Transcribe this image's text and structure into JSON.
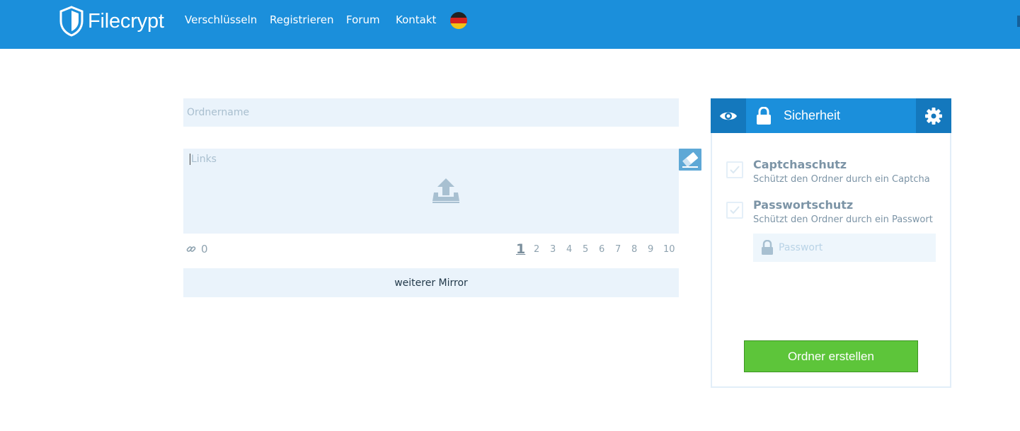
{
  "header": {
    "brand": "Filecrypt",
    "nav": [
      "Verschlüsseln",
      "Registrieren",
      "Forum",
      "Kontakt"
    ],
    "language_icon": "german-flag-icon"
  },
  "form": {
    "folder_name_placeholder": "Ordnername",
    "links_placeholder": "Links",
    "link_count": "0",
    "pages": [
      "1",
      "2",
      "3",
      "4",
      "5",
      "6",
      "7",
      "8",
      "9",
      "10"
    ],
    "active_page": "1",
    "mirror_button": "weiterer Mirror"
  },
  "security": {
    "title": "Sicherheit",
    "options": [
      {
        "title": "Captchaschutz",
        "desc": "Schützt den Ordner durch ein Captcha"
      },
      {
        "title": "Passwortschutz",
        "desc": "Schützt den Ordner durch ein Passwort"
      }
    ],
    "password_placeholder": "Passwort",
    "submit": "Ordner erstellen"
  },
  "colors": {
    "header_bg": "#1b8fdb",
    "field_bg": "#eaf3fb",
    "button_green": "#5dc53a"
  }
}
